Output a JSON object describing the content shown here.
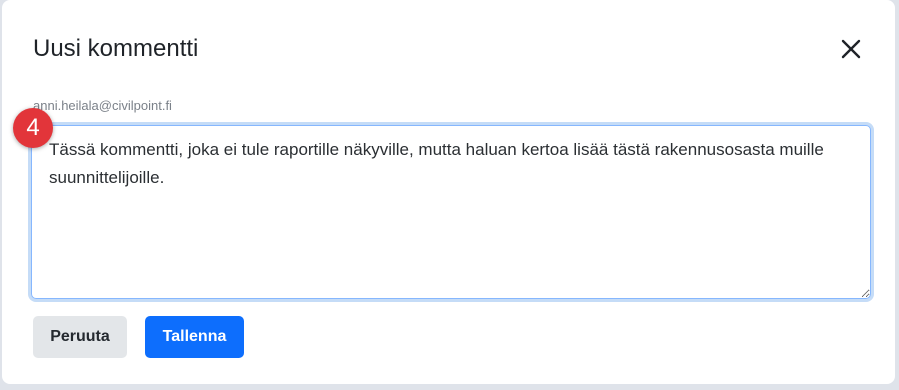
{
  "dialog": {
    "title": "Uusi kommentti",
    "close_icon": "close-icon",
    "author": "anni.heilala@civilpoint.fi",
    "step_badge": "4",
    "comment_text": "Tässä kommentti, joka ei tule raportille näkyville, mutta haluan kertoa lisää tästä rakennusosasta muille suunnittelijoille.",
    "cancel_label": "Peruuta",
    "save_label": "Tallenna"
  },
  "colors": {
    "primary": "#0d6efd",
    "badge": "#e2353a",
    "focus_ring": "#c5dcf7"
  }
}
